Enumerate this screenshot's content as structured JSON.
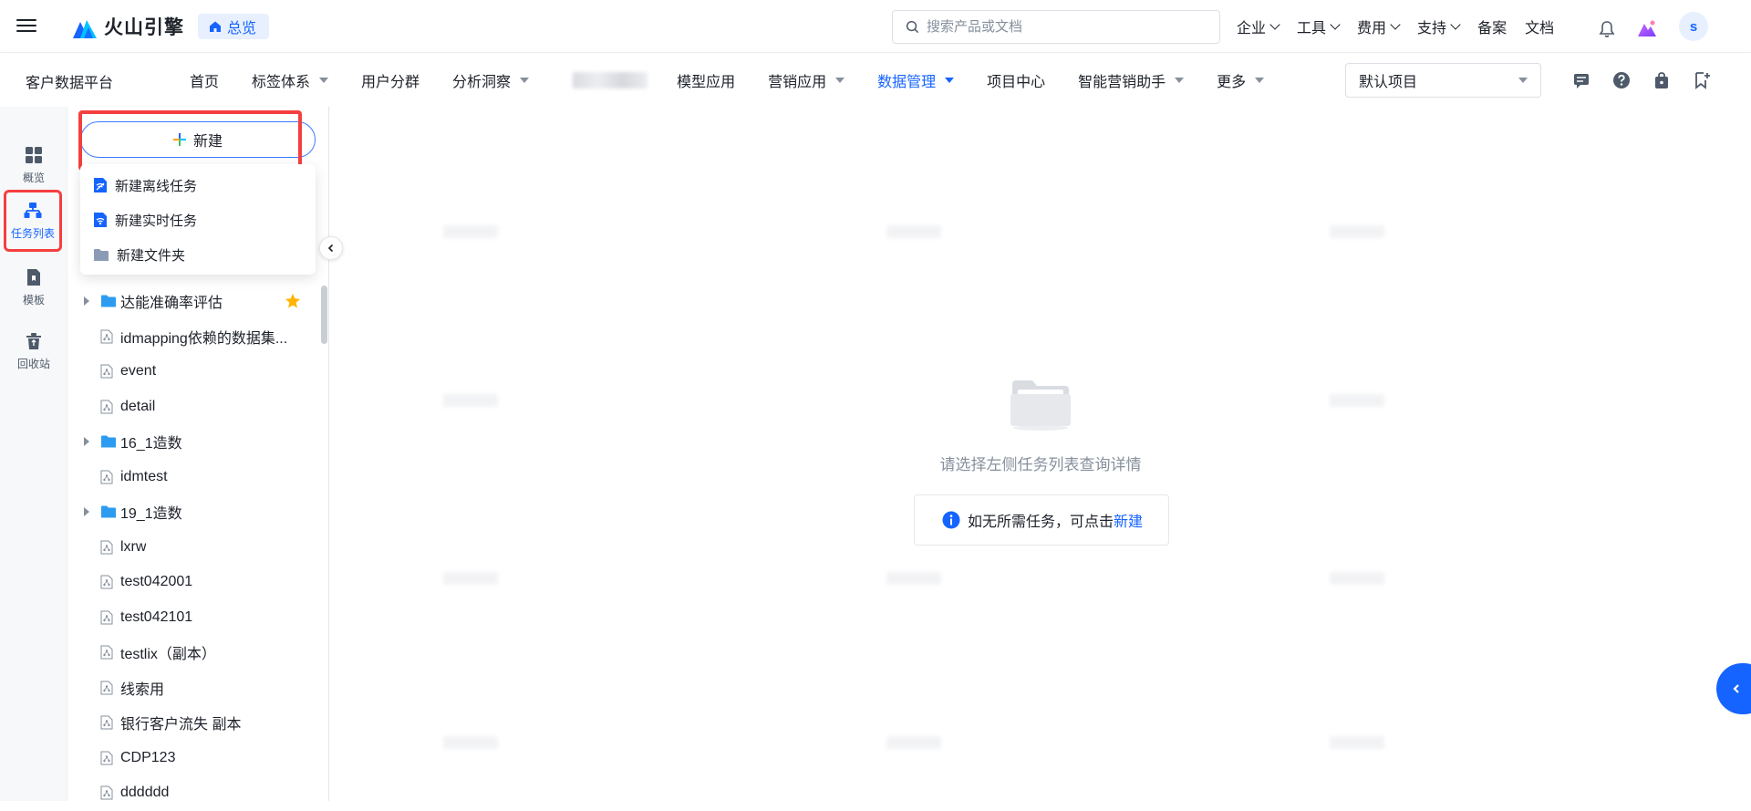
{
  "header": {
    "brand": "火山引擎",
    "overview_label": "总览",
    "search_placeholder": "搜索产品或文档",
    "nav": [
      {
        "label": "企业"
      },
      {
        "label": "工具"
      },
      {
        "label": "费用"
      },
      {
        "label": "支持"
      },
      {
        "label": "备案"
      },
      {
        "label": "文档"
      }
    ],
    "avatar_initial": "s"
  },
  "subnav": {
    "platform": "客户数据平台",
    "items": [
      {
        "label": "首页",
        "dropdown": false
      },
      {
        "label": "标签体系",
        "dropdown": true
      },
      {
        "label": "用户分群",
        "dropdown": false
      },
      {
        "label": "分析洞察",
        "dropdown": true
      },
      {
        "label": "模型应用",
        "dropdown": false
      },
      {
        "label": "营销应用",
        "dropdown": true
      },
      {
        "label": "数据管理",
        "dropdown": true,
        "active": true
      },
      {
        "label": "项目中心",
        "dropdown": false
      },
      {
        "label": "智能营销助手",
        "dropdown": true
      },
      {
        "label": "更多",
        "dropdown": true
      }
    ],
    "project": "默认项目"
  },
  "leftrail": [
    {
      "label": "概览",
      "icon": "grid-icon"
    },
    {
      "label": "任务列表",
      "icon": "task-list-icon",
      "active": true
    },
    {
      "label": "模板",
      "icon": "template-icon"
    },
    {
      "label": "回收站",
      "icon": "recycle-bin-icon"
    }
  ],
  "taskpanel": {
    "new_label": "新建",
    "dropdown": [
      {
        "label": "新建离线任务",
        "icon": "offline-task-icon"
      },
      {
        "label": "新建实时任务",
        "icon": "realtime-task-icon"
      },
      {
        "label": "新建文件夹",
        "icon": "folder-icon"
      }
    ],
    "tree": [
      {
        "label": "达能准确率评估",
        "type": "folder",
        "starred": true
      },
      {
        "label": "idmapping依赖的数据集...",
        "type": "task"
      },
      {
        "label": "event",
        "type": "task"
      },
      {
        "label": "detail",
        "type": "task"
      },
      {
        "label": "16_1造数",
        "type": "folder"
      },
      {
        "label": "idmtest",
        "type": "task"
      },
      {
        "label": "19_1造数",
        "type": "folder"
      },
      {
        "label": "lxrw",
        "type": "task"
      },
      {
        "label": "test042001",
        "type": "task"
      },
      {
        "label": "test042101",
        "type": "task"
      },
      {
        "label": "testlix（副本）",
        "type": "task"
      },
      {
        "label": "线索用",
        "type": "task"
      },
      {
        "label": "银行客户流失 副本",
        "type": "task"
      },
      {
        "label": "CDP123",
        "type": "task"
      },
      {
        "label": "dddddd",
        "type": "task"
      }
    ]
  },
  "main": {
    "empty_text": "请选择左侧任务列表查询详情",
    "hint_text": "如无所需任务，可点击",
    "hint_link": "新建"
  },
  "colors": {
    "accent": "#1664ff",
    "highlight": "#f53f3f",
    "star": "#ffb400",
    "folder": "#2d9cf0"
  }
}
